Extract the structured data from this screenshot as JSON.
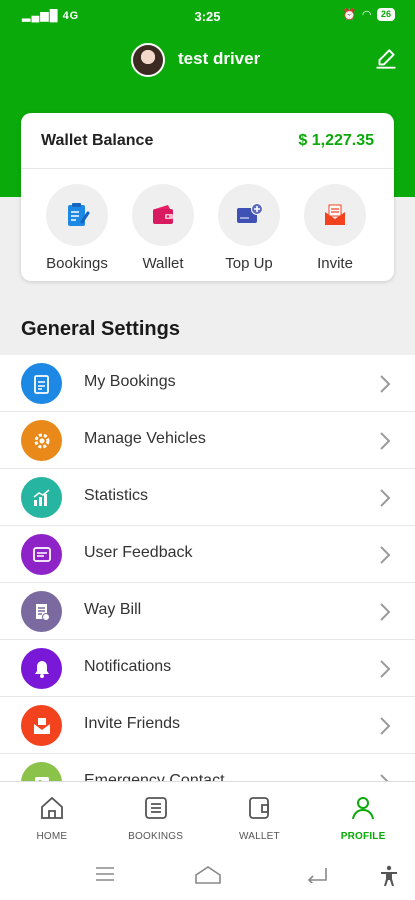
{
  "status_bar": {
    "time": "3:25",
    "left": "4G",
    "battery": "26"
  },
  "header": {
    "driver_name": "test driver"
  },
  "wallet": {
    "label": "Wallet Balance",
    "amount": "$ 1,227.35",
    "shortcuts": [
      {
        "label": "Bookings",
        "icon": "bookings-icon"
      },
      {
        "label": "Wallet",
        "icon": "wallet-icon"
      },
      {
        "label": "Top Up",
        "icon": "top-up-icon"
      },
      {
        "label": "Invite",
        "icon": "invite-icon"
      }
    ]
  },
  "general_settings": {
    "title": "General Settings",
    "items": [
      {
        "label": "My Bookings",
        "color": "#1e88e5",
        "icon": "clipboard-icon"
      },
      {
        "label": "Manage Vehicles",
        "color": "#e8891a",
        "icon": "gear-icon"
      },
      {
        "label": "Statistics",
        "color": "#26b5a0",
        "icon": "chart-icon"
      },
      {
        "label": "User Feedback",
        "color": "#8e24c8",
        "icon": "feedback-icon"
      },
      {
        "label": "Way Bill",
        "color": "#7b6aa0",
        "icon": "bill-icon"
      },
      {
        "label": "Notifications",
        "color": "#7a18d8",
        "icon": "bell-icon"
      },
      {
        "label": "Invite Friends",
        "color": "#f2431e",
        "icon": "envelope-icon"
      },
      {
        "label": "Emergency Contact",
        "color": "#8bc34a",
        "icon": "contact-icon"
      }
    ]
  },
  "bottom_nav": {
    "items": [
      {
        "label": "HOME",
        "icon": "home-icon"
      },
      {
        "label": "BOOKINGS",
        "icon": "list-icon"
      },
      {
        "label": "WALLET",
        "icon": "wallet-icon"
      },
      {
        "label": "PROFILE",
        "icon": "profile-icon"
      }
    ],
    "active": "PROFILE",
    "active_color": "#0aaa0a"
  }
}
